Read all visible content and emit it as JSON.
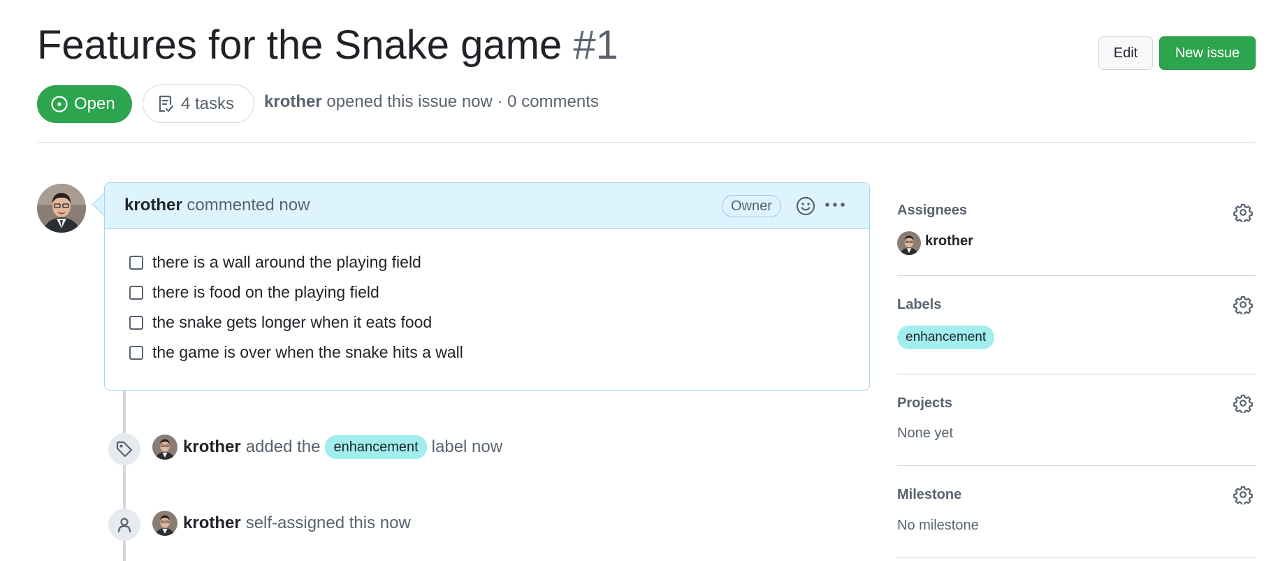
{
  "issue": {
    "title": "Features for the Snake game",
    "number": "#1",
    "state": "Open",
    "tasks": "4 tasks",
    "author": "krother",
    "meta_text": "opened this issue now · 0 comments"
  },
  "actions": {
    "edit_label": "Edit",
    "new_issue_label": "New issue"
  },
  "comment": {
    "author": "krother",
    "when": "commented now",
    "role_badge": "Owner",
    "tasks": [
      {
        "label": "there is a wall around the playing field",
        "checked": false
      },
      {
        "label": "there is food on the playing field",
        "checked": false
      },
      {
        "label": "the snake gets longer when it eats food",
        "checked": false
      },
      {
        "label": "the game is over when the snake hits a wall",
        "checked": false
      }
    ]
  },
  "timeline": [
    {
      "icon": "tag-icon",
      "actor": "krother",
      "pre": "added the",
      "label": "enhancement",
      "post": "label now"
    },
    {
      "icon": "person-icon",
      "actor": "krother",
      "text": "self-assigned this now"
    }
  ],
  "sidebar": {
    "assignees": {
      "title": "Assignees",
      "user": "krother"
    },
    "labels": {
      "title": "Labels",
      "items": [
        "enhancement"
      ]
    },
    "projects": {
      "title": "Projects",
      "value": "None yet"
    },
    "milestone": {
      "title": "Milestone",
      "value": "No milestone"
    }
  },
  "colors": {
    "open_green": "#2da44e",
    "label_bg": "#a2eeef",
    "comment_header_bg": "#ddf4ff",
    "comment_border": "#a8d1f0"
  }
}
